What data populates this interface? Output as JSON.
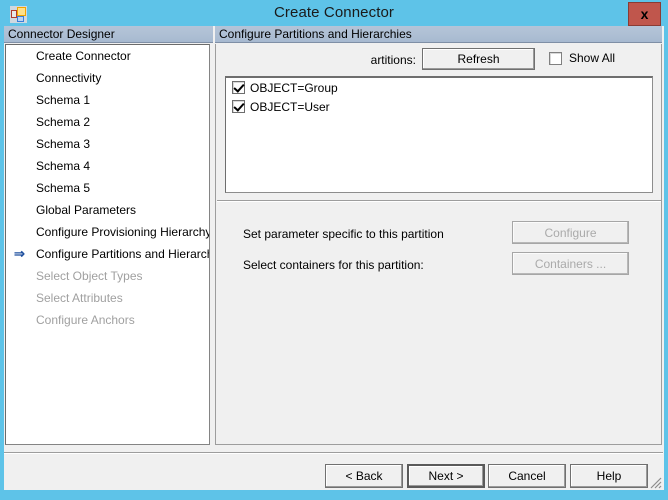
{
  "window": {
    "title": "Create Connector",
    "app_icon": "application-icon",
    "close_label": "x",
    "frame_color": "#5ec3e8",
    "close_button_color": "#c0564c"
  },
  "sidebar": {
    "header": "Connector Designer",
    "items": [
      {
        "label": "Create Connector",
        "state": "enabled",
        "current": false
      },
      {
        "label": "Connectivity",
        "state": "enabled",
        "current": false
      },
      {
        "label": "Schema 1",
        "state": "enabled",
        "current": false
      },
      {
        "label": "Schema 2",
        "state": "enabled",
        "current": false
      },
      {
        "label": "Schema 3",
        "state": "enabled",
        "current": false
      },
      {
        "label": "Schema 4",
        "state": "enabled",
        "current": false
      },
      {
        "label": "Schema 5",
        "state": "enabled",
        "current": false
      },
      {
        "label": "Global Parameters",
        "state": "enabled",
        "current": false
      },
      {
        "label": "Configure Provisioning Hierarchy",
        "state": "enabled",
        "current": false
      },
      {
        "label": "Configure Partitions and Hierarchies",
        "state": "enabled",
        "current": true,
        "marker": "⇒"
      },
      {
        "label": "Select Object Types",
        "state": "disabled",
        "current": false
      },
      {
        "label": "Select Attributes",
        "state": "disabled",
        "current": false
      },
      {
        "label": "Configure Anchors",
        "state": "disabled",
        "current": false
      }
    ]
  },
  "main": {
    "header": "Configure Partitions and Hierarchies",
    "partitions_label": "artitions:",
    "refresh_label": "Refresh",
    "show_all": {
      "label": "Show All",
      "checked": false
    },
    "partitions": [
      {
        "label": "OBJECT=Group",
        "checked": true
      },
      {
        "label": "OBJECT=User",
        "checked": true
      }
    ],
    "parameter_row": {
      "label": "Set parameter specific to this partition",
      "button_label": "Configure",
      "button_enabled": false
    },
    "containers_row": {
      "label": "Select containers for this partition:",
      "button_label": "Containers ...",
      "button_enabled": false
    }
  },
  "footer": {
    "back_label": "< Back",
    "next_label": "Next  >",
    "cancel_label": "Cancel",
    "help_label": "Help",
    "resize_grip": "resize-grip"
  }
}
